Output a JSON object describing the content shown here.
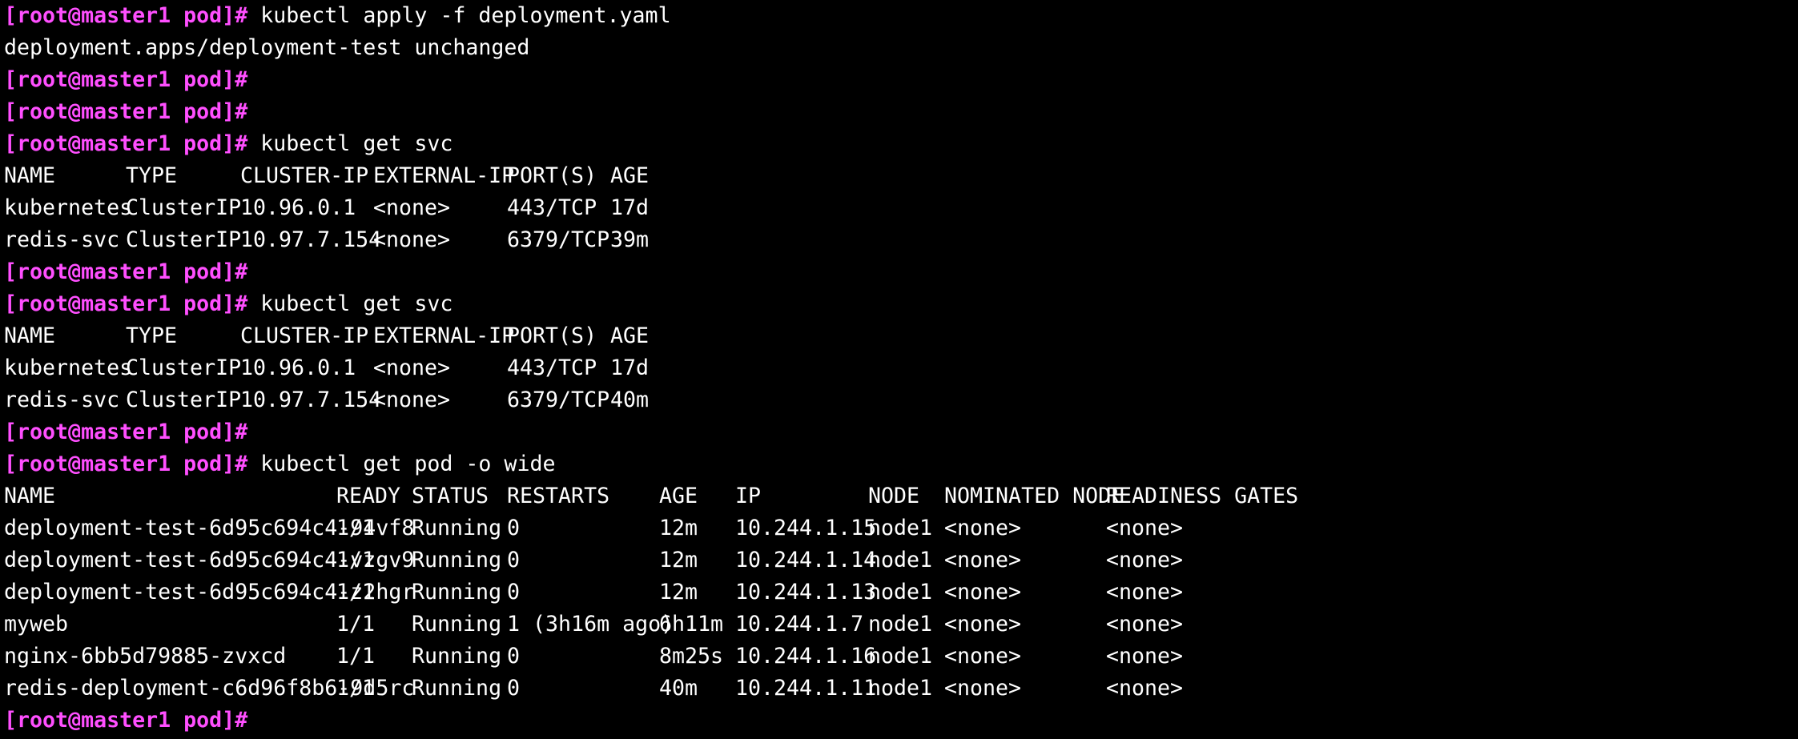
{
  "prompt": "[root@master1 pod]#",
  "colors": {
    "background": "#000000",
    "text": "#ffffff",
    "prompt": "#ff4fff"
  },
  "lines": [
    {
      "type": "cmd",
      "command": "kubectl apply -f deployment.yaml"
    },
    {
      "type": "out",
      "text": "deployment.apps/deployment-test unchanged"
    },
    {
      "type": "cmd",
      "command": ""
    },
    {
      "type": "cmd",
      "command": ""
    },
    {
      "type": "cmd",
      "command": "kubectl get svc"
    },
    {
      "type": "svc",
      "cells": [
        "NAME",
        "TYPE",
        "CLUSTER-IP",
        "EXTERNAL-IP",
        "PORT(S)",
        "AGE"
      ]
    },
    {
      "type": "svc",
      "cells": [
        "kubernetes",
        "ClusterIP",
        "10.96.0.1",
        "<none>",
        "443/TCP",
        "17d"
      ]
    },
    {
      "type": "svc",
      "cells": [
        "redis-svc",
        "ClusterIP",
        "10.97.7.154",
        "<none>",
        "6379/TCP",
        "39m"
      ]
    },
    {
      "type": "cmd",
      "command": ""
    },
    {
      "type": "cmd",
      "command": "kubectl get svc"
    },
    {
      "type": "svc",
      "cells": [
        "NAME",
        "TYPE",
        "CLUSTER-IP",
        "EXTERNAL-IP",
        "PORT(S)",
        "AGE"
      ]
    },
    {
      "type": "svc",
      "cells": [
        "kubernetes",
        "ClusterIP",
        "10.96.0.1",
        "<none>",
        "443/TCP",
        "17d"
      ]
    },
    {
      "type": "svc",
      "cells": [
        "redis-svc",
        "ClusterIP",
        "10.97.7.154",
        "<none>",
        "6379/TCP",
        "40m"
      ]
    },
    {
      "type": "cmd",
      "command": ""
    },
    {
      "type": "cmd",
      "command": "kubectl get pod -o wide"
    },
    {
      "type": "pod",
      "cells": [
        "NAME",
        "READY",
        "STATUS",
        "RESTARTS",
        "AGE",
        "IP",
        "NODE",
        "NOMINATED NODE",
        "READINESS GATES"
      ]
    },
    {
      "type": "pod",
      "cells": [
        "deployment-test-6d95c694c4-94vf8",
        "1/1",
        "Running",
        "0",
        "12m",
        "10.244.1.15",
        "node1",
        "<none>",
        "<none>"
      ]
    },
    {
      "type": "pod",
      "cells": [
        "deployment-test-6d95c694c4-vzgv9",
        "1/1",
        "Running",
        "0",
        "12m",
        "10.244.1.14",
        "node1",
        "<none>",
        "<none>"
      ]
    },
    {
      "type": "pod",
      "cells": [
        "deployment-test-6d95c694c4-z2hgr",
        "1/1",
        "Running",
        "0",
        "12m",
        "10.244.1.13",
        "node1",
        "<none>",
        "<none>"
      ]
    },
    {
      "type": "pod",
      "cells": [
        "myweb",
        "1/1",
        "Running",
        "1 (3h16m ago)",
        "6h11m",
        "10.244.1.7",
        "node1",
        "<none>",
        "<none>"
      ]
    },
    {
      "type": "pod",
      "cells": [
        "nginx-6bb5d79885-zvxcd",
        "1/1",
        "Running",
        "0",
        "8m25s",
        "10.244.1.16",
        "node1",
        "<none>",
        "<none>"
      ]
    },
    {
      "type": "pod",
      "cells": [
        "redis-deployment-c6d96f8b6-9d5rc",
        "1/1",
        "Running",
        "0",
        "40m",
        "10.244.1.11",
        "node1",
        "<none>",
        "<none>"
      ]
    },
    {
      "type": "cmd",
      "command": ""
    }
  ]
}
